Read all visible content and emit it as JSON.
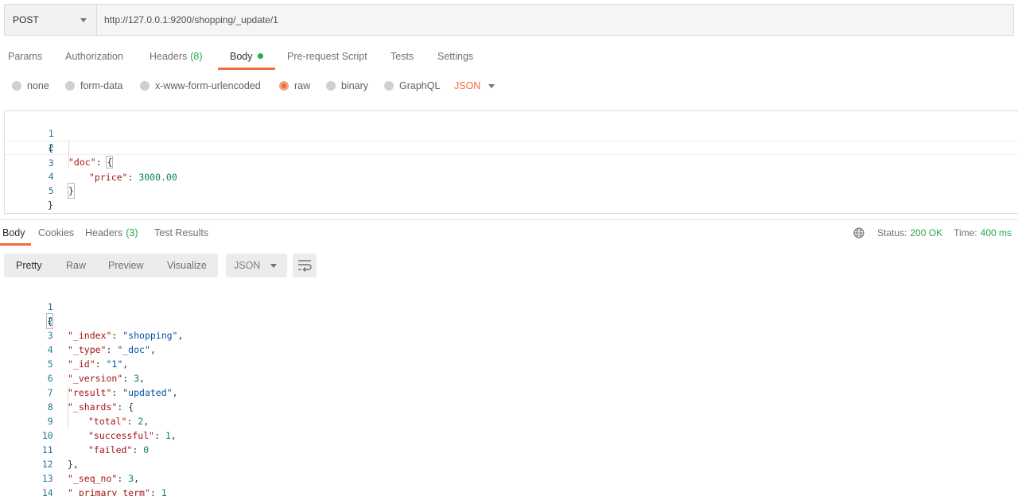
{
  "request": {
    "method": "POST",
    "url": "http://127.0.0.1:9200/shopping/_update/1"
  },
  "request_tabs": [
    {
      "label": "Params"
    },
    {
      "label": "Authorization"
    },
    {
      "label": "Headers",
      "count": "(8)"
    },
    {
      "label": "Body",
      "active": true
    },
    {
      "label": "Pre-request Script"
    },
    {
      "label": "Tests"
    },
    {
      "label": "Settings"
    }
  ],
  "body_types": {
    "options": [
      "none",
      "form-data",
      "x-www-form-urlencoded",
      "raw",
      "binary",
      "GraphQL"
    ],
    "selected": "raw",
    "format": "JSON"
  },
  "request_body_lines": [
    "1",
    "2",
    "3",
    "4",
    "5"
  ],
  "request_body": {
    "doc_key": "\"doc\"",
    "price_key": "\"price\"",
    "price_value": "3000.00"
  },
  "response_tabs": [
    {
      "label": "Body",
      "active": true
    },
    {
      "label": "Cookies"
    },
    {
      "label": "Headers",
      "count": "(3)"
    },
    {
      "label": "Test Results"
    }
  ],
  "response_status": {
    "status_label": "Status:",
    "status_value": "200 OK",
    "time_label": "Time:",
    "time_value": "400 ms"
  },
  "response_views": {
    "options": [
      "Pretty",
      "Raw",
      "Preview",
      "Visualize"
    ],
    "active": "Pretty",
    "format": "JSON"
  },
  "response_body_lines": [
    "1",
    "2",
    "3",
    "4",
    "5",
    "6",
    "7",
    "8",
    "9",
    "10",
    "11",
    "12",
    "13",
    "14"
  ],
  "response_body": {
    "index_key": "\"_index\"",
    "index_value": "\"shopping\"",
    "type_key": "\"_type\"",
    "type_value": "\"_doc\"",
    "id_key": "\"_id\"",
    "id_value": "\"1\"",
    "version_key": "\"_version\"",
    "version_value": "3",
    "result_key": "\"result\"",
    "result_value": "\"updated\"",
    "shards_key": "\"_shards\"",
    "total_key": "\"total\"",
    "total_value": "2",
    "successful_key": "\"successful\"",
    "successful_value": "1",
    "failed_key": "\"failed\"",
    "failed_value": "0",
    "seq_key": "\"_seq_no\"",
    "seq_value": "3",
    "term_key": "\"_primary_term\"",
    "term_value": "1"
  },
  "colors": {
    "accent": "#f26b3a",
    "success": "#26a94a",
    "json_key": "#a31515",
    "json_string": "#0451a5",
    "json_number": "#098658",
    "line_number": "#237893"
  },
  "icons": [
    "chevron-down-icon",
    "globe-icon",
    "wrap-lines-icon"
  ]
}
